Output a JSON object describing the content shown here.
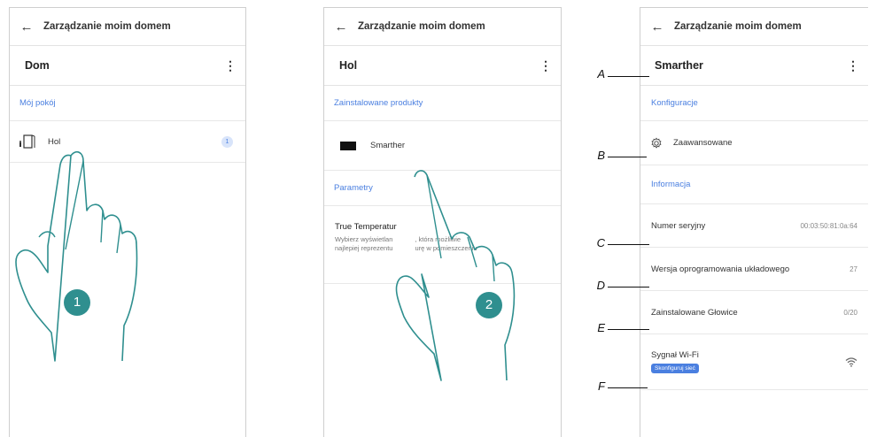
{
  "screen1": {
    "back_icon": "arrow-left-icon",
    "header_title": "Zarządzanie moim domem",
    "title": "Dom",
    "menu_icon": "kebab-icon",
    "section_label": "Mój pokój",
    "room_label": "Hol",
    "room_count": "1",
    "room_icon": "door-icon"
  },
  "screen2": {
    "back_icon": "arrow-left-icon",
    "header_title": "Zarządzanie moim domem",
    "title": "Hol",
    "menu_icon": "kebab-icon",
    "section_products": "Zainstalowane produkty",
    "product_label": "Smarther",
    "section_params": "Parametry",
    "param_title": "True Temperatur",
    "param_desc_line1": "Wybierz wyświetlan            , która możliwie",
    "param_desc_line2": "najlepiej reprezentu            urę w pomieszczeniu"
  },
  "screen3": {
    "back_icon": "arrow-left-icon",
    "header_title": "Zarządzanie moim domem",
    "title": "Smarther",
    "menu_icon": "kebab-icon",
    "section_config": "Konfiguracje",
    "advanced_label": "Zaawansowane",
    "section_info": "Informacja",
    "serial_label": "Numer seryjny",
    "serial_value": "00:03:50:81:0a:64",
    "firmware_label": "Wersja oprogramowania układowego",
    "firmware_value": "27",
    "heads_label": "Zainstalowane Głowice",
    "heads_value": "0/20",
    "wifi_label": "Sygnał Wi-Fi",
    "wifi_button": "Skonfiguruj sieć",
    "wifi_icon": "wifi-icon"
  },
  "callouts": [
    "A",
    "B",
    "C",
    "D",
    "E",
    "F"
  ],
  "steps": [
    "1",
    "2"
  ],
  "colors": {
    "accent": "#4a7fe0",
    "step_badge": "#2f8f8f",
    "hand_outline": "#2f8f8f"
  }
}
